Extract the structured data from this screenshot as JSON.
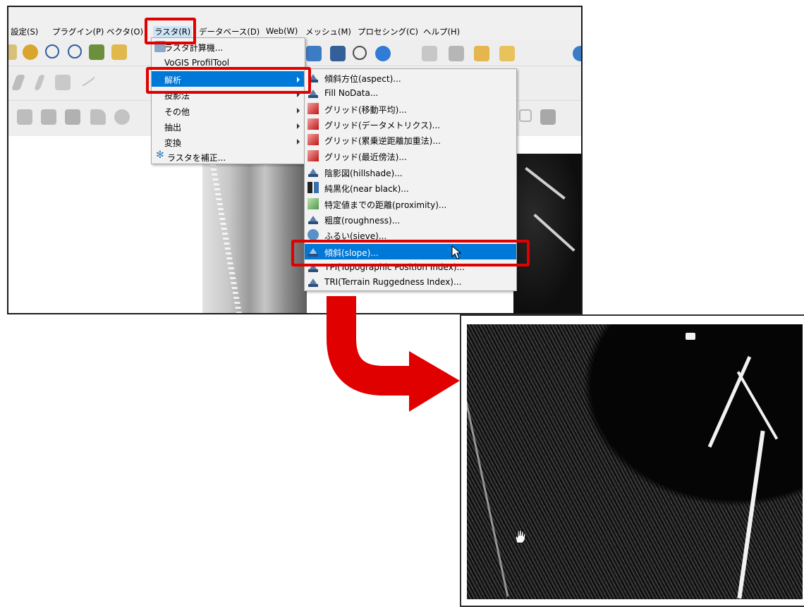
{
  "menubar": {
    "items": [
      "設定(S)",
      "プラグイン(P)",
      "ベクタ(O)",
      "ラスタ(R)",
      "データベース(D)",
      "Web(W)",
      "メッシュ(M)",
      "プロセシング(C)",
      "ヘルプ(H)"
    ]
  },
  "toolbar": {
    "px_unit": "px"
  },
  "raster_menu": {
    "items": [
      {
        "label": "ラスタ計算機...",
        "icon": "raster-calculator-icon"
      },
      {
        "label": "VoGIS ProfilTool",
        "icon": ""
      },
      {
        "label": "解析",
        "icon": "",
        "submenu": true,
        "highlighted": true
      },
      {
        "label": "投影法",
        "icon": "",
        "submenu": true
      },
      {
        "label": "その他",
        "icon": "",
        "submenu": true
      },
      {
        "label": "抽出",
        "icon": "",
        "submenu": true
      },
      {
        "label": "変換",
        "icon": "",
        "submenu": true
      },
      {
        "label": "ラスタを補正...",
        "icon": "gear-icon"
      }
    ]
  },
  "analysis_submenu": {
    "items": [
      {
        "label": "傾斜方位(aspect)...",
        "icon": "gdal-icon"
      },
      {
        "label": "Fill NoData...",
        "icon": "gdal-icon"
      },
      {
        "label": "グリッド(移動平均)...",
        "icon": "grid-icon"
      },
      {
        "label": "グリッド(データメトリクス)...",
        "icon": "grid-icon"
      },
      {
        "label": "グリッド(累乗逆距離加重法)...",
        "icon": "grid-icon"
      },
      {
        "label": "グリッド(最近傍法)...",
        "icon": "grid-icon"
      },
      {
        "label": "陰影図(hillshade)...",
        "icon": "gdal-icon"
      },
      {
        "label": "純黒化(near black)...",
        "icon": "near-black-icon"
      },
      {
        "label": "特定値までの距離(proximity)...",
        "icon": "proximity-icon"
      },
      {
        "label": "粗度(roughness)...",
        "icon": "gdal-icon"
      },
      {
        "label": "ふるい(sieve)...",
        "icon": "sieve-icon"
      },
      {
        "label": "傾斜(slope)...",
        "icon": "gdal-icon",
        "highlighted": true
      },
      {
        "label": "TPI(Topographic Position Index)...",
        "icon": "gdal-icon"
      },
      {
        "label": "TRI(Terrain Ruggedness Index)...",
        "icon": "gdal-icon"
      }
    ]
  },
  "colors": {
    "highlight": "#0078d7",
    "annotation_red": "#e00000"
  }
}
